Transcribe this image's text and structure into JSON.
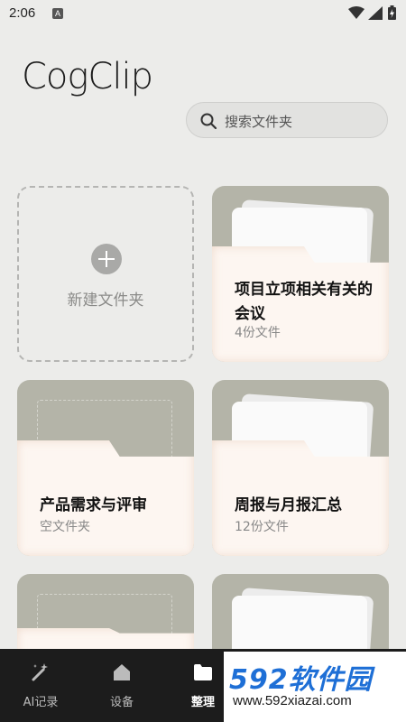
{
  "status_bar": {
    "time": "2:06",
    "notification_letter": "A"
  },
  "app": {
    "logo": "CogClip"
  },
  "search": {
    "placeholder": "搜索文件夹"
  },
  "new_folder": {
    "label": "新建文件夹"
  },
  "folders": [
    {
      "title": "项目立项相关有关的会议",
      "subtitle": "4份文件"
    },
    {
      "title": "产品需求与评审",
      "subtitle": "空文件夹"
    },
    {
      "title": "周报与月报汇总",
      "subtitle": "12份文件"
    }
  ],
  "bottom_nav": [
    {
      "label": "AI记录"
    },
    {
      "label": "设备"
    },
    {
      "label": "整理"
    }
  ],
  "watermark": {
    "main": "592软件园",
    "url": "www.592xiazai.com"
  },
  "colors": {
    "folder_back": "#b4b4a8",
    "folder_front": "#fdf6f1",
    "nav_bg": "#1c1c1c",
    "watermark_blue": "#1e6fd6"
  }
}
